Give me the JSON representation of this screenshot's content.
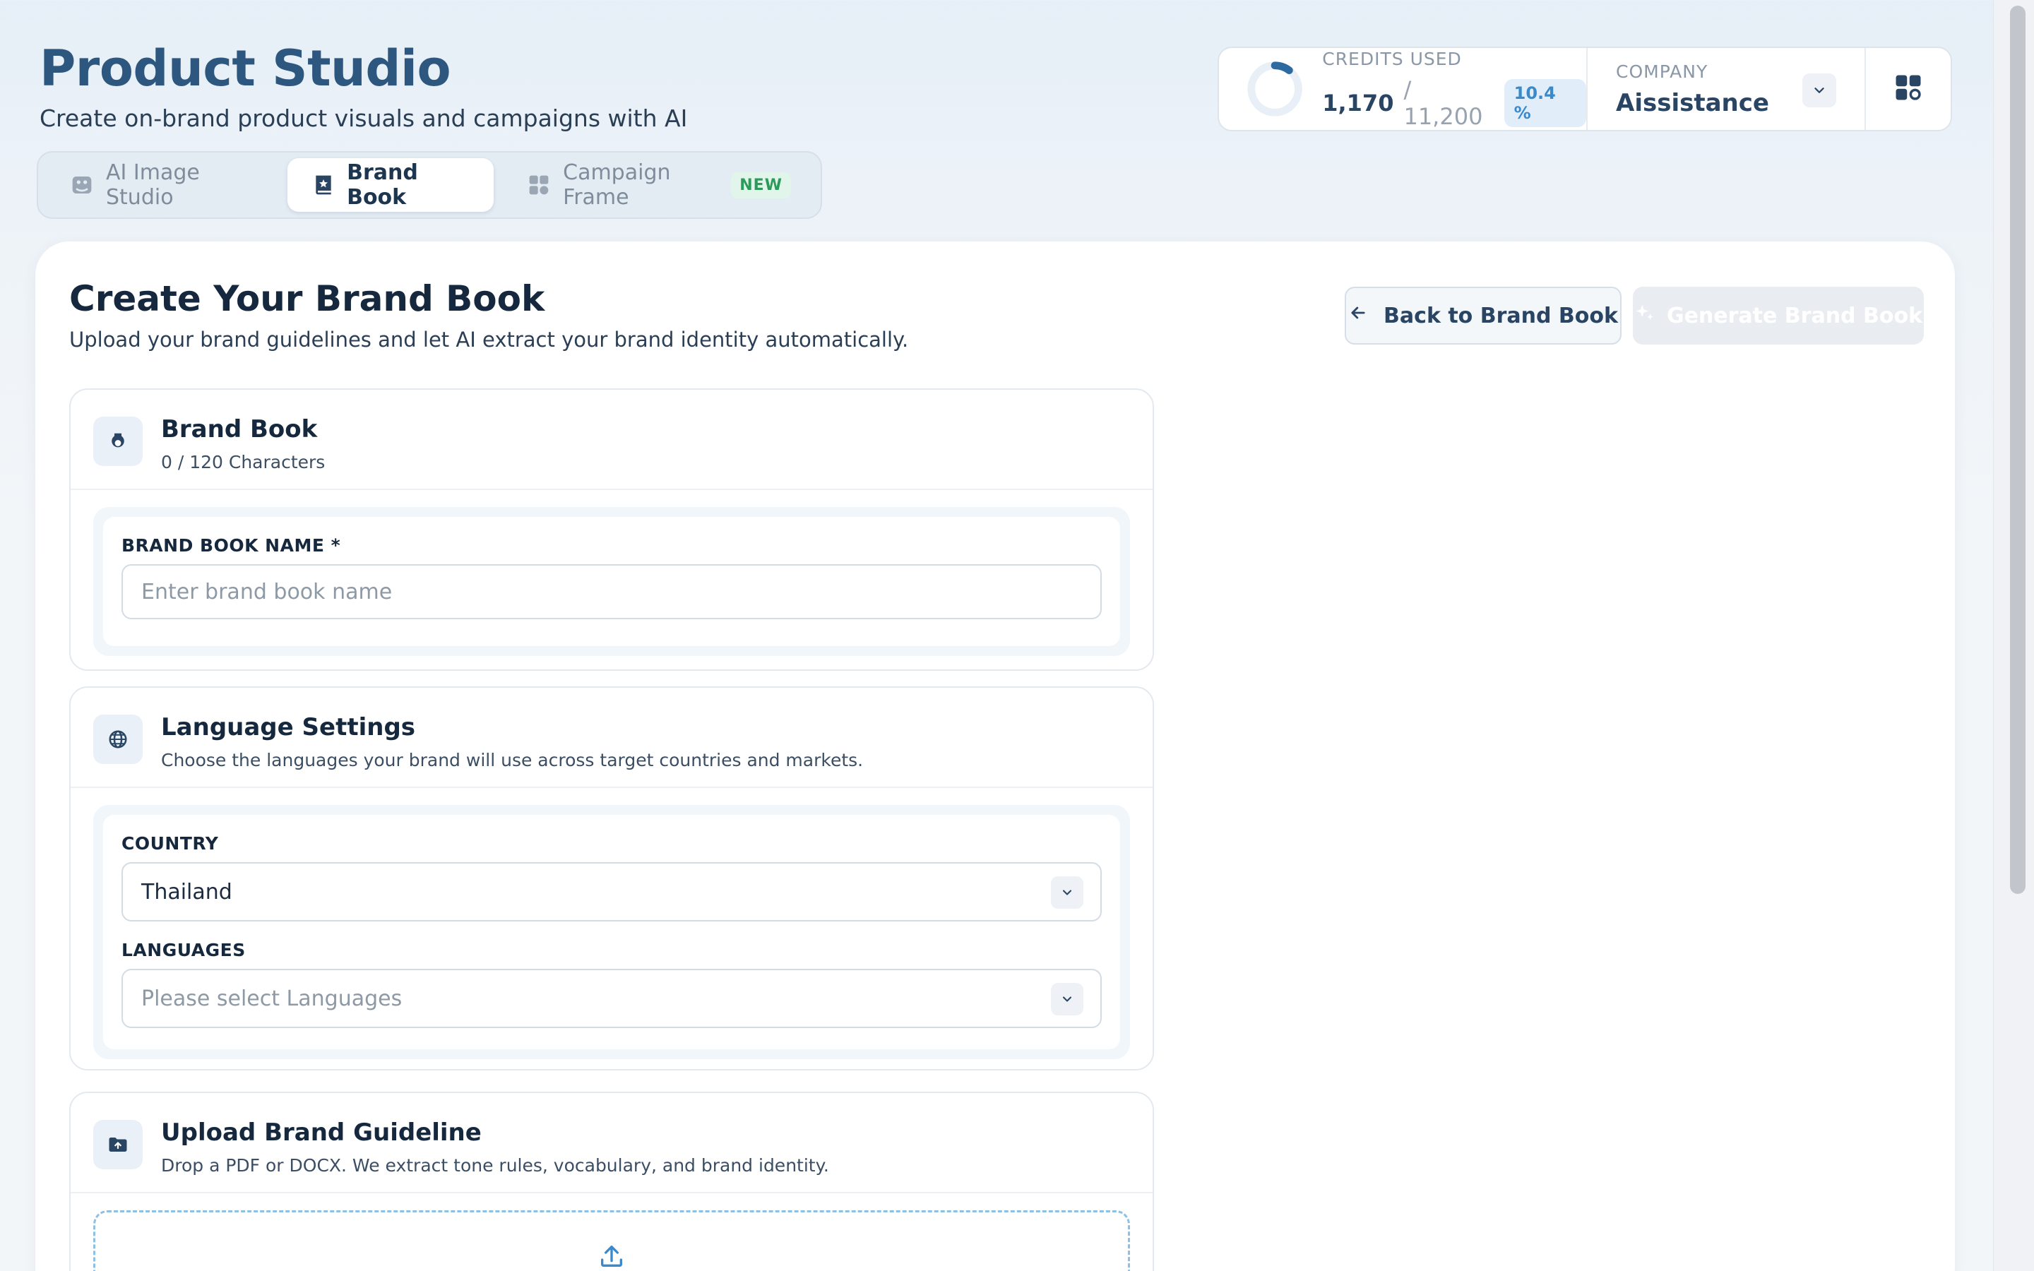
{
  "app": {
    "title": "Product Studio",
    "subtitle": "Create on-brand product visuals and campaigns with AI"
  },
  "tabs": [
    {
      "label": "AI Image Studio",
      "icon": "image-icon",
      "active": false
    },
    {
      "label": "Brand Book",
      "icon": "book-icon",
      "active": true
    },
    {
      "label": "Campaign Frame",
      "icon": "grid-icon",
      "active": false,
      "badge": "NEW"
    }
  ],
  "stats": {
    "credits_label": "CREDITS USED",
    "credits_used": "1,170",
    "credits_total": "/ 11,200",
    "credits_percent": "10.4 %",
    "credits_fraction": 0.104,
    "company_label": "COMPANY",
    "company_name": "Aissistance"
  },
  "page": {
    "title": "Create Your Brand Book",
    "subtitle": "Upload your brand guidelines and let AI extract your brand identity automatically.",
    "back_label": "Back to Brand Book",
    "generate_label": "Generate Brand Book"
  },
  "brand_book": {
    "title": "Brand Book",
    "char_count": "0 / 120 Characters",
    "name_label": "BRAND BOOK NAME *",
    "name_placeholder": "Enter brand book name"
  },
  "language": {
    "title": "Language Settings",
    "description": "Choose the languages your brand will use across target countries and markets.",
    "country_label": "COUNTRY",
    "country_value": "Thailand",
    "languages_label": "LANGUAGES",
    "languages_placeholder": "Please select Languages"
  },
  "upload": {
    "title": "Upload Brand Guideline",
    "description": "Drop a PDF or DOCX. We extract tone rules, vocabulary, and brand identity."
  },
  "colors": {
    "accent": "#2e5780",
    "ring": "#2d6aa0",
    "badge_green": "#2b9a5a"
  }
}
